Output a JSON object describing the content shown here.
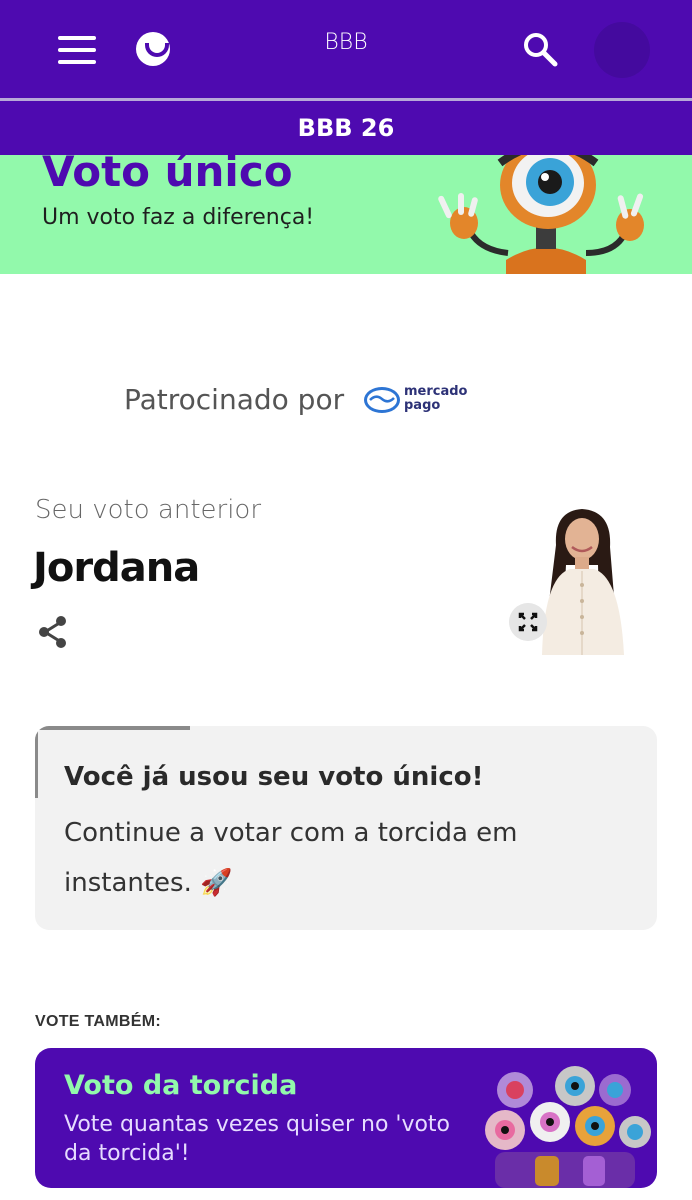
{
  "header": {
    "title": "BBB",
    "menu_icon": "hamburger-menu-icon",
    "logo_icon": "globo-logo-icon",
    "search_icon": "search-icon",
    "brand_color": "#4e0ab0"
  },
  "subheader": {
    "title": "BBB 26"
  },
  "banner": {
    "title": "Voto único",
    "subtitle": "Um voto faz a diferença!",
    "background": "#92f9ab"
  },
  "sponsor": {
    "label": "Patrocinado por",
    "brand_line1": "mercado",
    "brand_line2": "pago"
  },
  "previous_vote": {
    "label": "Seu voto anterior",
    "name": "Jordana"
  },
  "info_card": {
    "title": "Você já usou seu voto único!",
    "text": "Continue a votar com a torcida em instantes. 🚀"
  },
  "vote_also": {
    "label": "VOTE TAMBÉM:",
    "card_title": "Voto da torcida",
    "card_text": "Vote quantas vezes quiser no 'voto da torcida'!"
  }
}
